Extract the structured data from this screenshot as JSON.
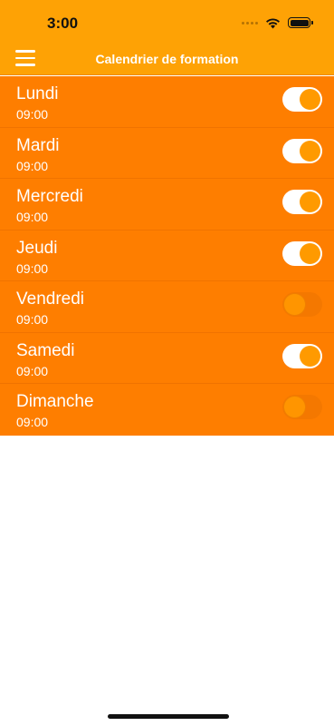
{
  "status_bar": {
    "time": "3:00",
    "icons": [
      "signal-dots-icon",
      "wifi-icon",
      "battery-icon"
    ]
  },
  "nav": {
    "title": "Calendrier de formation",
    "menu_icon": "hamburger-menu-icon"
  },
  "colors": {
    "header_bg": "#fea205",
    "list_bg": "#fe7e00",
    "text": "#ffffff",
    "toggle_knob": "#ff9a00"
  },
  "days": [
    {
      "name": "Lundi",
      "time": "09:00",
      "enabled": true
    },
    {
      "name": "Mardi",
      "time": "09:00",
      "enabled": true
    },
    {
      "name": "Mercredi",
      "time": "09:00",
      "enabled": true
    },
    {
      "name": "Jeudi",
      "time": "09:00",
      "enabled": true
    },
    {
      "name": "Vendredi",
      "time": "09:00",
      "enabled": false
    },
    {
      "name": "Samedi",
      "time": "09:00",
      "enabled": true
    },
    {
      "name": "Dimanche",
      "time": "09:00",
      "enabled": false
    }
  ]
}
